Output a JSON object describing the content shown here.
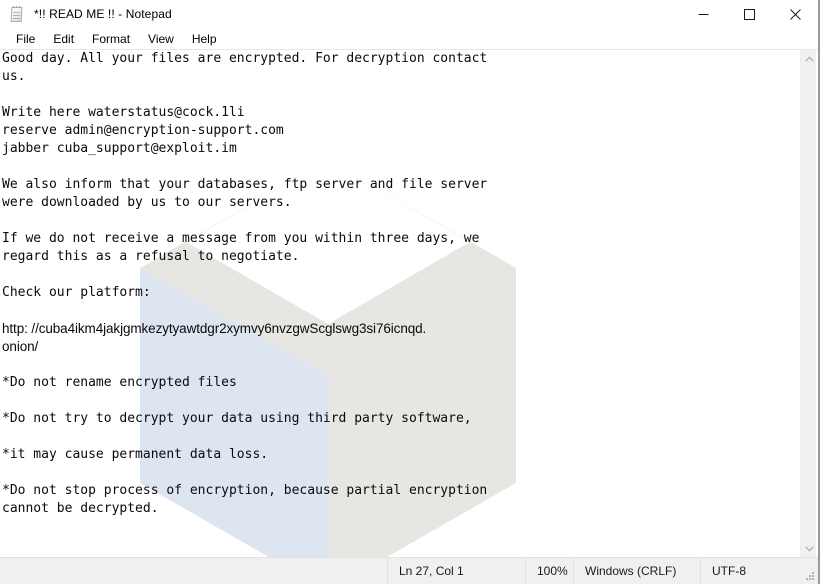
{
  "window": {
    "title": "*!! READ ME !! - Notepad",
    "app_icon": "notepad-icon"
  },
  "window_controls": {
    "minimize": "minimize-icon",
    "maximize": "maximize-icon",
    "close": "close-icon"
  },
  "menubar": {
    "items": [
      {
        "label": "File"
      },
      {
        "label": "Edit"
      },
      {
        "label": "Format"
      },
      {
        "label": "View"
      },
      {
        "label": "Help"
      }
    ]
  },
  "document": {
    "lines": [
      {
        "text": "Good day. All your files are encrypted. For decryption contact",
        "font": "mono"
      },
      {
        "text": "us.",
        "font": "mono"
      },
      {
        "text": "",
        "font": "mono"
      },
      {
        "text": "Write here waterstatus@cock.1li",
        "font": "mono"
      },
      {
        "text": "reserve admin@encryption-support.com",
        "font": "mono"
      },
      {
        "text": "jabber cuba_support@exploit.im",
        "font": "mono"
      },
      {
        "text": "",
        "font": "mono"
      },
      {
        "text": "We also inform that your databases, ftp server and file server",
        "font": "mono"
      },
      {
        "text": "were downloaded by us to our servers.",
        "font": "mono"
      },
      {
        "text": "",
        "font": "mono"
      },
      {
        "text": "If we do not receive a message from you within three days, we",
        "font": "mono"
      },
      {
        "text": "regard this as a refusal to negotiate.",
        "font": "mono"
      },
      {
        "text": "",
        "font": "mono"
      },
      {
        "text": "Check our platform:",
        "font": "mono"
      },
      {
        "text": "",
        "font": "mono"
      },
      {
        "text": "http: //cuba4ikm4jakjgmkezytyawtdgr2xymvy6nvzgwScglswg3si76icnqd.",
        "font": "prop"
      },
      {
        "text": "onion/",
        "font": "prop"
      },
      {
        "text": "",
        "font": "mono"
      },
      {
        "text": "*Do not rename encrypted files",
        "font": "mono"
      },
      {
        "text": "",
        "font": "mono"
      },
      {
        "text": "*Do not try to decrypt your data using third party software,",
        "font": "mono"
      },
      {
        "text": "",
        "font": "mono"
      },
      {
        "text": "*it may cause permanent data loss.",
        "font": "mono"
      },
      {
        "text": "",
        "font": "mono"
      },
      {
        "text": "*Do not stop process of encryption, because partial encryption",
        "font": "mono"
      },
      {
        "text": "cannot be decrypted.",
        "font": "mono"
      }
    ]
  },
  "watermark": {
    "name": "isometric-cube-watermark",
    "color_warm_gray": "#e8e6e2",
    "color_blue_gray": "#dde5f0",
    "color_top_face": "#ffffff"
  },
  "scrollbar": {
    "up_arrow": "chevron-up-icon",
    "down_arrow": "chevron-down-icon"
  },
  "statusbar": {
    "cursor_position": "Ln 27, Col 1",
    "zoom": "100%",
    "line_ending": "Windows (CRLF)",
    "encoding": "UTF-8"
  }
}
